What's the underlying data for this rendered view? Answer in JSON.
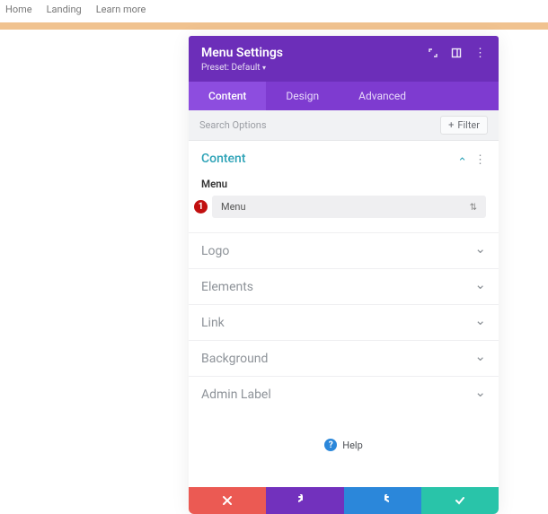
{
  "nav": {
    "items": [
      "Home",
      "Landing",
      "Learn more"
    ]
  },
  "panel": {
    "title": "Menu Settings",
    "preset_label": "Preset: Default",
    "tabs": [
      "Content",
      "Design",
      "Advanced"
    ],
    "active_tab": 0,
    "search_placeholder": "Search Options",
    "filter_label": "Filter"
  },
  "sections": {
    "content": {
      "title": "Content",
      "menu_field_label": "Menu",
      "menu_dropdown_value": "Menu",
      "badge_number": "1"
    },
    "closed": [
      "Logo",
      "Elements",
      "Link",
      "Background",
      "Admin Label"
    ]
  },
  "help_label": "Help"
}
